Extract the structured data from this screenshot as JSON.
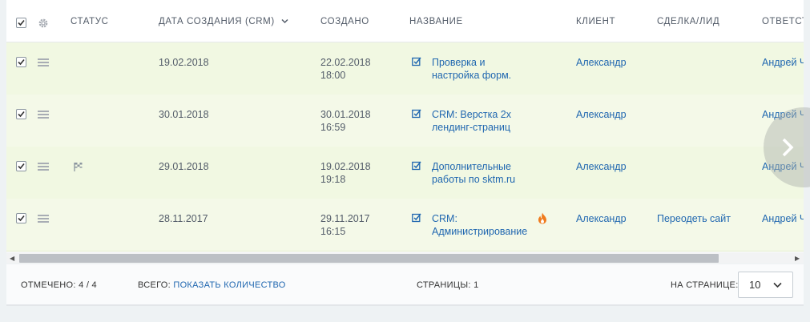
{
  "header": {
    "status": "СТАТУС",
    "created_date": "ДАТА СОЗДАНИЯ (CRM)",
    "created": "СОЗДАНО",
    "name": "НАЗВАНИЕ",
    "client": "КЛИЕНТ",
    "deal": "СДЕЛКА/ЛИД",
    "responsible": "ОТВЕТСТВ"
  },
  "rows": [
    {
      "checked": true,
      "date": "19.02.2018",
      "created_date": "22.02.2018",
      "created_time": "18:00",
      "name_line1": "Проверка и",
      "name_line2": "настройка форм.",
      "client": "Александр",
      "deal": "",
      "responsible": "Андрей Ч",
      "flag": false,
      "hot": false
    },
    {
      "checked": true,
      "date": "30.01.2018",
      "created_date": "30.01.2018",
      "created_time": "16:59",
      "name_line1": "CRM: Верстка 2х",
      "name_line2": "лендинг-страниц",
      "client": "Александр",
      "deal": "",
      "responsible": "Андрей Ч",
      "flag": false,
      "hot": false
    },
    {
      "checked": true,
      "date": "29.01.2018",
      "created_date": "19.02.2018",
      "created_time": "19:18",
      "name_line1": "Дополнительные",
      "name_line2": "работы по sktm.ru",
      "client": "Александр",
      "deal": "",
      "responsible": "Андрей Ч",
      "flag": true,
      "hot": false
    },
    {
      "checked": true,
      "date": "28.11.2017",
      "created_date": "29.11.2017",
      "created_time": "16:15",
      "name_line1": "CRM:",
      "name_line2": "Администрирование",
      "client": "Александр",
      "deal": "Переодеть сайт",
      "responsible": "Андрей Ч",
      "flag": false,
      "hot": true
    }
  ],
  "footer": {
    "marked_label": "ОТМЕЧЕНО:",
    "marked_value": "4 / 4",
    "total_label": "ВСЕГО:",
    "total_link": "ПОКАЗАТЬ КОЛИЧЕСТВО",
    "pages_label": "СТРАНИЦЫ:",
    "pages_value": "1",
    "per_page_label": "НА СТРАНИЦЕ:",
    "per_page_value": "10"
  },
  "colors": {
    "link": "#2067b0",
    "row_bg": "#f1f8e2",
    "hot": "#f07b1d"
  },
  "icons": [
    "gear-icon",
    "chevron-down-icon",
    "drag-menu-icon",
    "task-check-icon",
    "flag-icon",
    "fire-icon",
    "chevron-right-icon"
  ]
}
